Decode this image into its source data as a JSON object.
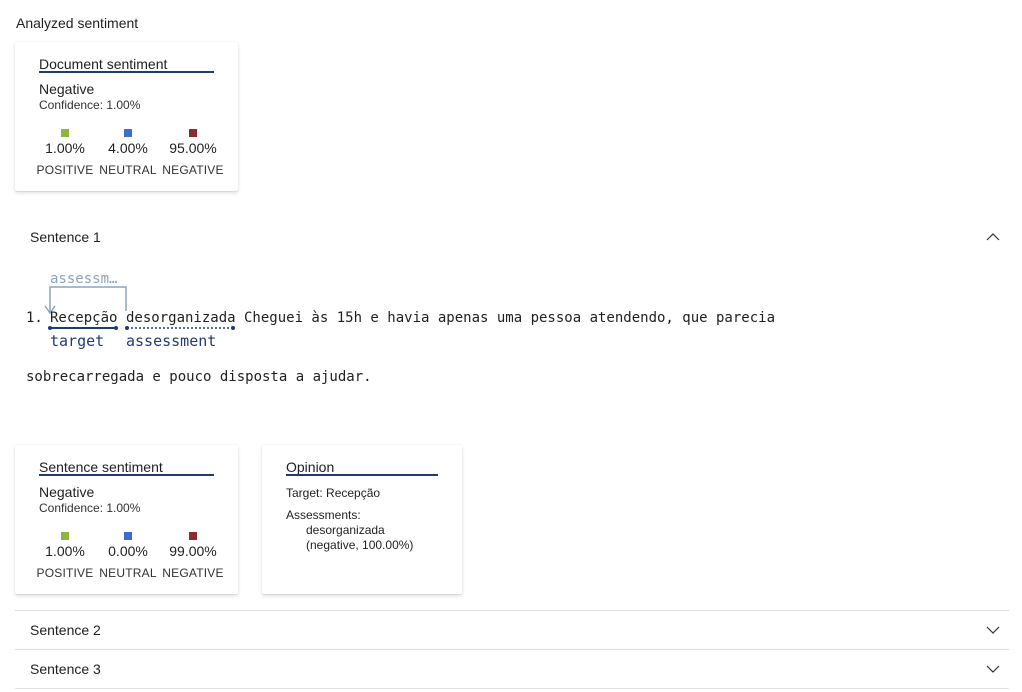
{
  "heading": "Analyzed sentiment",
  "document_card": {
    "title": "Document sentiment",
    "sentiment": "Negative",
    "confidence": "Confidence: 1.00%",
    "scores": [
      {
        "value": "1.00%",
        "label": "POSITIVE",
        "color": "#8cb63c"
      },
      {
        "value": "4.00%",
        "label": "NEUTRAL",
        "color": "#3b6ed3"
      },
      {
        "value": "95.00%",
        "label": "NEGATIVE",
        "color": "#8c2b2b"
      }
    ]
  },
  "sentence1": {
    "title": "Sentence 1",
    "number": "1.",
    "target_word": "Recepção",
    "assessment_word": "desorganizada",
    "rest_line1": "Cheguei às 15h e havia apenas uma pessoa atendendo, que parecia",
    "line2": "sobrecarregada e pouco disposta a ajudar.",
    "target_tag": "target",
    "assessment_tag": "assessment",
    "link_tag": "assessm…",
    "sentence_card": {
      "title": "Sentence sentiment",
      "sentiment": "Negative",
      "confidence": "Confidence: 1.00%",
      "scores": [
        {
          "value": "1.00%",
          "label": "POSITIVE",
          "color": "#8cb63c"
        },
        {
          "value": "0.00%",
          "label": "NEUTRAL",
          "color": "#3b6ed3"
        },
        {
          "value": "99.00%",
          "label": "NEGATIVE",
          "color": "#8c2b2b"
        }
      ]
    },
    "opinion_card": {
      "title": "Opinion",
      "target_label": "Target:",
      "target_value": "Recepção",
      "assessments_label": "Assessments:",
      "assessment_value": "desorganizada",
      "assessment_detail": "(negative, 100.00%)"
    }
  },
  "sentence2": {
    "title": "Sentence 2"
  },
  "sentence3": {
    "title": "Sentence 3"
  },
  "colors": {
    "accent": "#1f3b73",
    "tag_faded": "#8aa3c4",
    "divider": "#e1dfdd"
  }
}
